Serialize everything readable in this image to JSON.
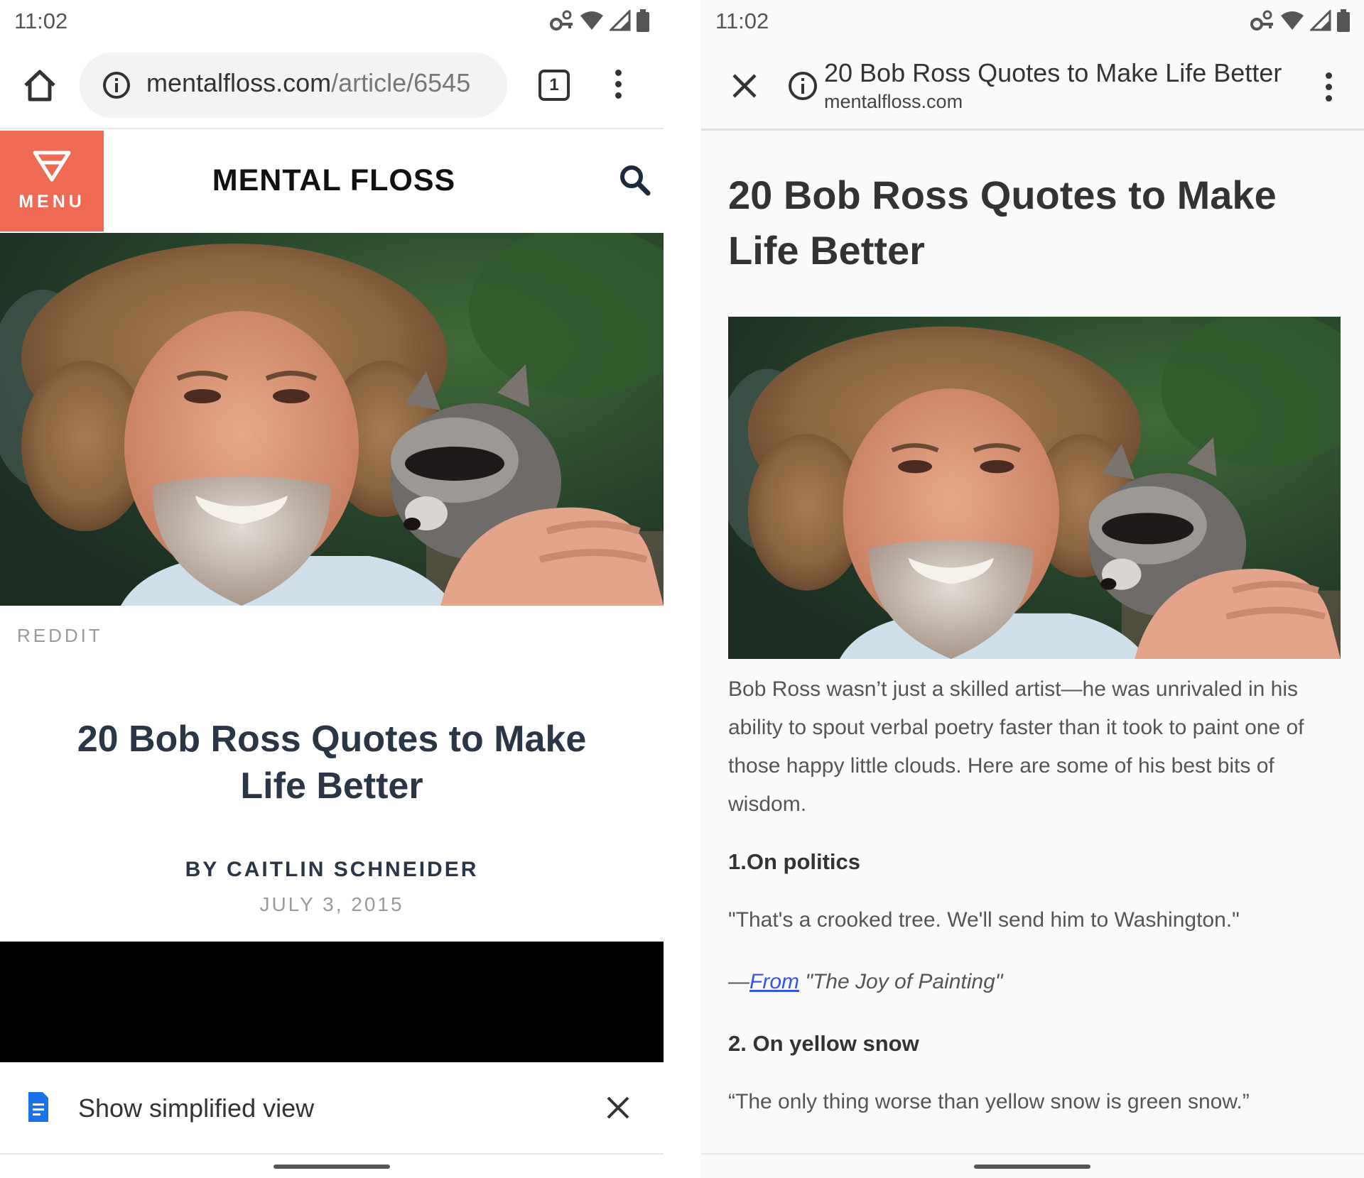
{
  "status_bar": {
    "time": "11:02"
  },
  "browser": {
    "url_host": "mentalfloss.com",
    "url_path": "/article/6545",
    "tab_count": "1"
  },
  "site": {
    "menu_label": "MENU",
    "brand": "MENTAL FLOSS"
  },
  "article": {
    "photo_credit": "REDDIT",
    "title": "20 Bob Ross Quotes to Make Life Better",
    "byline": "BY CAITLIN SCHNEIDER",
    "date": "JULY 3, 2015"
  },
  "simplified_prompt": {
    "label": "Show simplified view"
  },
  "custom_tab": {
    "title": "20 Bob Ross Quotes to Make Life Better",
    "host": "mentalfloss.com"
  },
  "reader": {
    "title": "20 Bob Ross Quotes to Make Life Better",
    "intro": "Bob Ross wasn’t just a skilled artist—he was unrivaled in his ability to spout verbal poetry faster than it took to paint one of those happy little clouds. Here are some of his best bits of wisdom.",
    "sections": [
      {
        "heading": "1.On politics",
        "quote": "\"That's a crooked tree. We'll send him to Washington.\"",
        "cite_dash": "—",
        "cite_link": "From",
        "cite_rest": " \"The Joy of Painting\""
      },
      {
        "heading": "2. On yellow snow",
        "quote": "“The only thing worse than yellow snow is green snow.”"
      }
    ]
  },
  "colors": {
    "menu_accent": "#ee6a55",
    "link": "#3355ee",
    "article_text": "#2a3545"
  },
  "icons": [
    "home-icon",
    "info-icon",
    "tabs-icon",
    "more-vert-icon",
    "search-icon",
    "close-icon",
    "document-icon",
    "wifi-icon",
    "signal-icon",
    "battery-icon",
    "vpn-key-icon"
  ]
}
